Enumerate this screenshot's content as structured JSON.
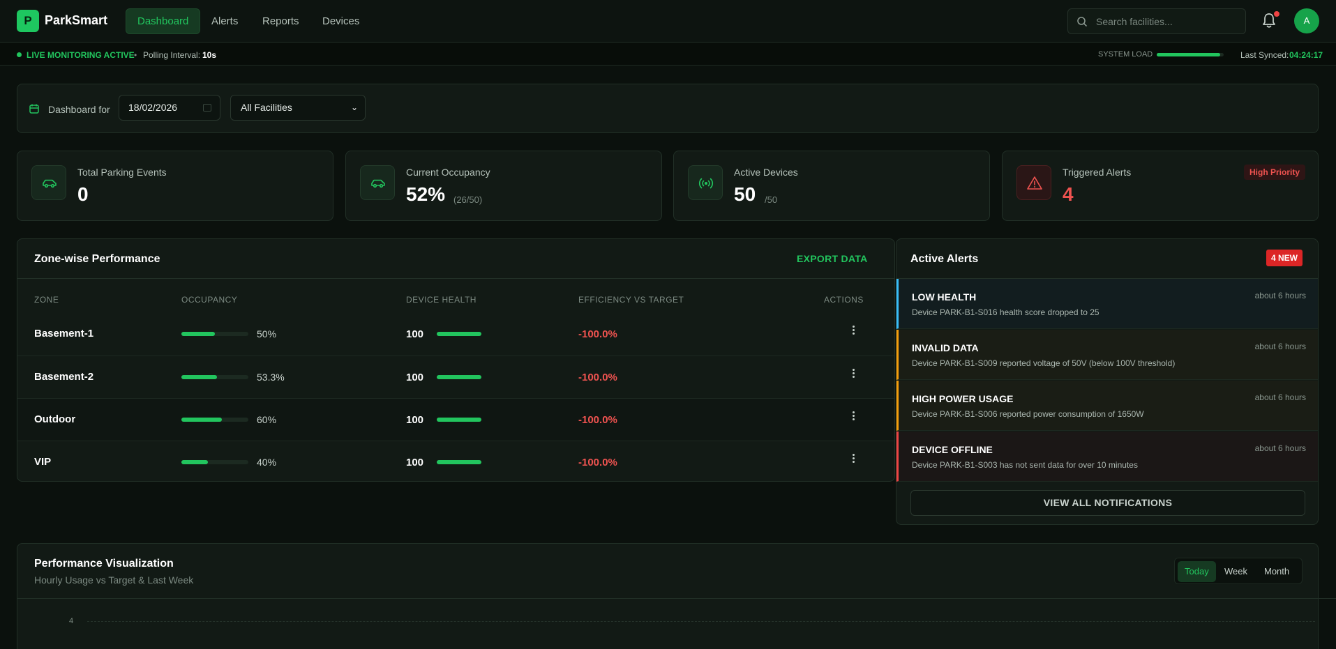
{
  "app": {
    "logo_letter": "P",
    "name": "ParkSmart"
  },
  "nav": {
    "tabs": [
      {
        "label": "Dashboard",
        "active": true
      },
      {
        "label": "Alerts",
        "active": false
      },
      {
        "label": "Reports",
        "active": false
      },
      {
        "label": "Devices",
        "active": false
      }
    ],
    "search_placeholder": "Search facilities...",
    "notification_unread": true,
    "avatar_initial": "A"
  },
  "status": {
    "live_label": "LIVE MONITORING ACTIVE",
    "polling_label": "Polling Interval:",
    "polling_value": "10s",
    "system_load_label": "SYSTEM LOAD",
    "system_load_fraction": 0.95,
    "last_synced_label": "Last Synced:",
    "last_synced_value": "04:24:17"
  },
  "filter": {
    "label": "Dashboard for",
    "date": "18/02/2026",
    "facility": "All Facilities"
  },
  "stats": [
    {
      "label": "Total Parking Events",
      "value": "0",
      "icon": "car-icon"
    },
    {
      "label": "Current Occupancy",
      "value": "52%",
      "sub": "(26/50)",
      "icon": "car-icon"
    },
    {
      "label": "Active Devices",
      "value": "50",
      "sub": "/50",
      "icon": "signal-icon"
    },
    {
      "label": "Triggered Alerts",
      "value": "4",
      "badge": "High Priority",
      "icon": "warning-icon"
    }
  ],
  "zones": {
    "title": "Zone-wise Performance",
    "export_label": "EXPORT DATA",
    "headers": {
      "zone": "ZONE",
      "occupancy": "OCCUPANCY",
      "health": "DEVICE HEALTH",
      "efficiency": "EFFICIENCY VS TARGET",
      "actions": "ACTIONS"
    },
    "rows": [
      {
        "name": "Basement-1",
        "occupancy_label": "50%",
        "occupancy": 0.5,
        "health": "100",
        "health_fraction": 1.0,
        "efficiency": "-100.0%"
      },
      {
        "name": "Basement-2",
        "occupancy_label": "53.3%",
        "occupancy": 0.533,
        "health": "100",
        "health_fraction": 1.0,
        "efficiency": "-100.0%"
      },
      {
        "name": "Outdoor",
        "occupancy_label": "60%",
        "occupancy": 0.6,
        "health": "100",
        "health_fraction": 1.0,
        "efficiency": "-100.0%"
      },
      {
        "name": "VIP",
        "occupancy_label": "40%",
        "occupancy": 0.4,
        "health": "100",
        "health_fraction": 1.0,
        "efficiency": "-100.0%"
      }
    ]
  },
  "alerts": {
    "title": "Active Alerts",
    "new_badge": "4 NEW",
    "items": [
      {
        "type": "LOW HEALTH",
        "time": "about 6 hours",
        "desc": "Device PARK-B1-S016 health score dropped to 25",
        "color": "#38bdf8"
      },
      {
        "type": "INVALID DATA",
        "time": "about 6 hours",
        "desc": "Device PARK-B1-S009 reported voltage of 50V (below 100V threshold)",
        "color": "#f59e0b"
      },
      {
        "type": "HIGH POWER USAGE",
        "time": "about 6 hours",
        "desc": "Device PARK-B1-S006 reported power consumption of 1650W",
        "color": "#f59e0b"
      },
      {
        "type": "DEVICE OFFLINE",
        "time": "about 6 hours",
        "desc": "Device PARK-B1-S003 has not sent data for over 10 minutes",
        "color": "#ef4444"
      }
    ],
    "view_all_label": "VIEW ALL NOTIFICATIONS"
  },
  "performance": {
    "title": "Performance Visualization",
    "subtitle": "Hourly Usage vs Target & Last Week",
    "ranges": [
      {
        "label": "Today",
        "active": true
      },
      {
        "label": "Week",
        "active": false
      },
      {
        "label": "Month",
        "active": false
      }
    ],
    "y_tick_top": "4"
  },
  "colors": {
    "accent": "#22c55e",
    "danger": "#ef4444",
    "background": "#0b110d"
  }
}
